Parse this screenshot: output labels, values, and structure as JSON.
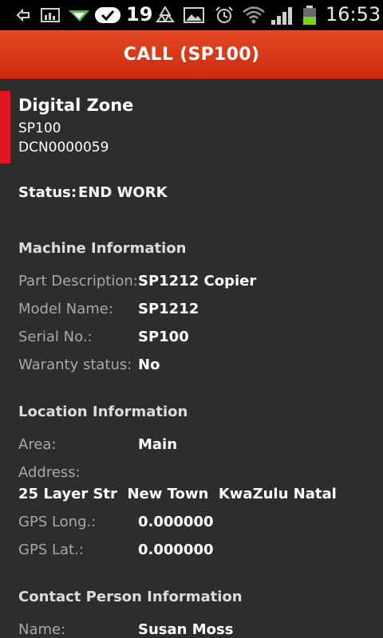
{
  "status_bar": {
    "notification_count": "19",
    "time": "16:53",
    "icons": [
      "back-icon",
      "chart-icon",
      "flag-icon",
      "check-badge-icon",
      "recycle-icon",
      "image-icon",
      "alarm-icon",
      "wifi-icon",
      "signal-icon",
      "battery-icon"
    ]
  },
  "action_bar": {
    "title": "CALL (SP100)"
  },
  "header": {
    "company": "Digital Zone",
    "code": "SP100",
    "call_number": "DCN0000059",
    "accent_color": "#e0151f"
  },
  "status": {
    "label": "Status:",
    "value": "END WORK"
  },
  "machine": {
    "title": "Machine Information",
    "rows": [
      {
        "label": "Part Description:",
        "value": "SP1212 Copier"
      },
      {
        "label": "Model Name:",
        "value": "SP1212"
      },
      {
        "label": "Serial No.:",
        "value": "SP100"
      },
      {
        "label": "Waranty status:",
        "value": "No"
      }
    ]
  },
  "location": {
    "title": "Location Information",
    "area_label": "Area:",
    "area_value": "Main",
    "address_label": "Address:",
    "address_value": "25 Layer Str  New Town  KwaZulu Natal",
    "gps_long_label": "GPS Long.:",
    "gps_long_value": "0.000000",
    "gps_lat_label": "GPS Lat.:",
    "gps_lat_value": "0.000000"
  },
  "contact": {
    "title": "Contact Person Information",
    "name_label": "Name:",
    "name_value": "Susan Moss"
  }
}
